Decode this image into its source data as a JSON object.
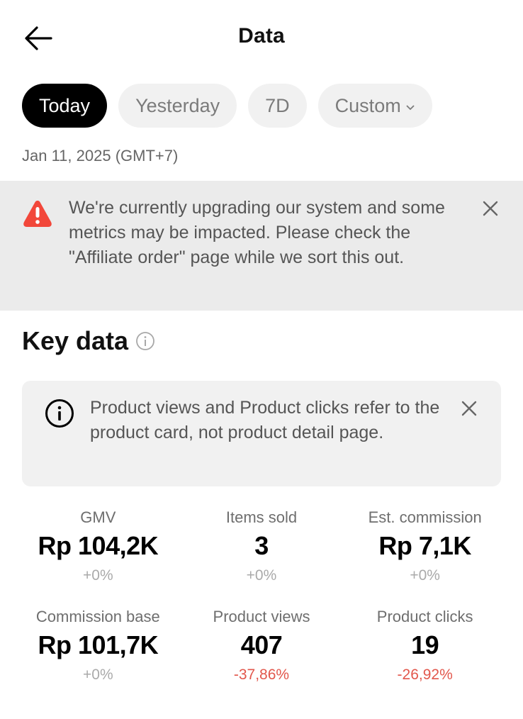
{
  "header": {
    "title": "Data",
    "back_icon": "arrow-left-icon"
  },
  "tabs": [
    {
      "label": "Today",
      "active": true
    },
    {
      "label": "Yesterday",
      "active": false
    },
    {
      "label": "7D",
      "active": false
    },
    {
      "label": "Custom",
      "active": false,
      "icon": "chevron-down-icon"
    }
  ],
  "date_label": "Jan 11, 2025 (GMT+7)",
  "warning_banner": {
    "icon": "warning-triangle-icon",
    "icon_color": "#f2473a",
    "text": "We're currently upgrading our system and some metrics may be impacted. Please check the \"Affiliate order\" page while we sort this out.",
    "close_icon": "close-icon"
  },
  "key_data": {
    "title": "Key data",
    "info_icon": "info-circle-icon",
    "notice": {
      "icon": "info-circle-icon",
      "text": "Product views and Product clicks refer to the product card, not product detail page.",
      "close_icon": "close-icon"
    },
    "metrics": [
      {
        "label": "GMV",
        "value": "Rp 104,2K",
        "change": "+0%",
        "trend": "neutral"
      },
      {
        "label": "Items sold",
        "value": "3",
        "change": "+0%",
        "trend": "neutral"
      },
      {
        "label": "Est. commission",
        "value": "Rp 7,1K",
        "change": "+0%",
        "trend": "neutral"
      },
      {
        "label": "Commission base",
        "value": "Rp 101,7K",
        "change": "+0%",
        "trend": "neutral"
      },
      {
        "label": "Product views",
        "value": "407",
        "change": "-37,86%",
        "trend": "negative"
      },
      {
        "label": "Product clicks",
        "value": "19",
        "change": "-26,92%",
        "trend": "negative"
      }
    ]
  },
  "colors": {
    "negative": "#e2574c",
    "neutral": "#aaaaaa",
    "active_tab": "#000000"
  }
}
